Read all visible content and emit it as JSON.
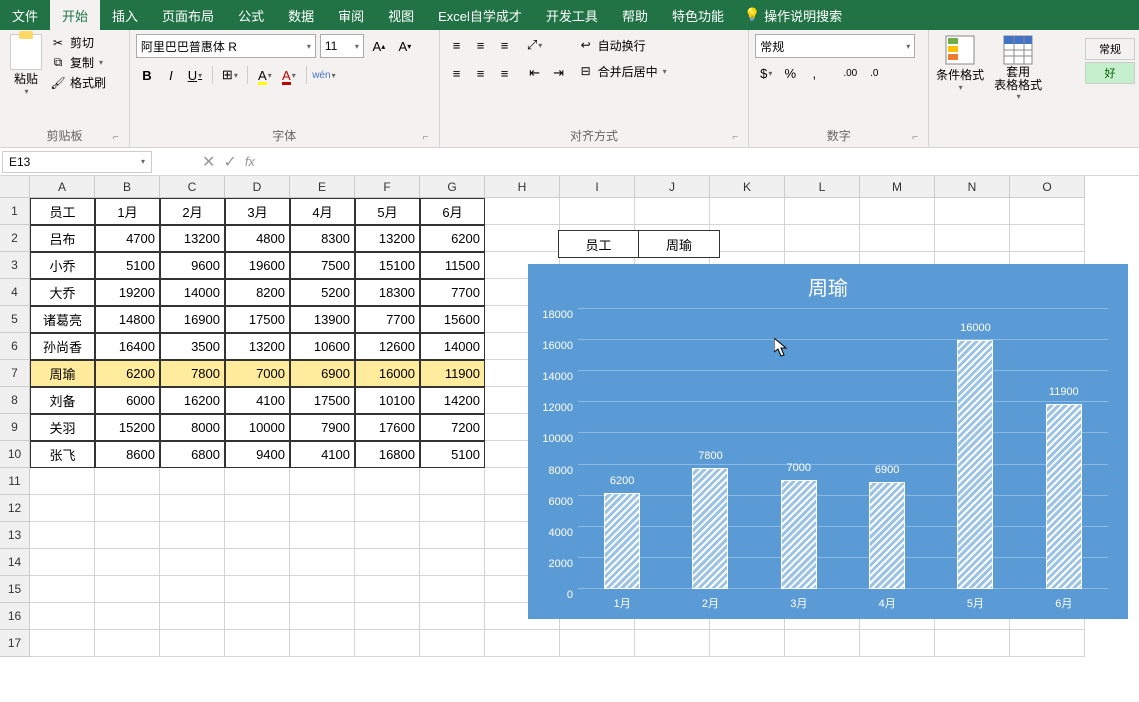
{
  "ribbon": {
    "tabs": [
      "文件",
      "开始",
      "插入",
      "页面布局",
      "公式",
      "数据",
      "审阅",
      "视图",
      "Excel自学成才",
      "开发工具",
      "帮助",
      "特色功能"
    ],
    "active_tab_index": 1,
    "tell_me": "操作说明搜索",
    "clipboard": {
      "paste": "粘贴",
      "cut": "剪切",
      "copy": "复制",
      "format_painter": "格式刷",
      "label": "剪贴板"
    },
    "font": {
      "family": "阿里巴巴普惠体 R",
      "size": "11",
      "label": "字体",
      "wen": "wén"
    },
    "align": {
      "wrap": "自动换行",
      "merge": "合并后居中",
      "label": "对齐方式"
    },
    "number": {
      "format": "常规",
      "label": "数字"
    },
    "styles": {
      "cond": "条件格式",
      "table": "套用\n表格格式",
      "normal": "常规",
      "good": "好"
    }
  },
  "namebox": "E13",
  "columns": [
    "A",
    "B",
    "C",
    "D",
    "E",
    "F",
    "G",
    "H",
    "I",
    "J",
    "K",
    "L",
    "M",
    "N",
    "O"
  ],
  "col_label_extra": "",
  "table": {
    "header": [
      "员工",
      "1月",
      "2月",
      "3月",
      "4月",
      "5月",
      "6月"
    ],
    "rows": [
      [
        "吕布",
        "4700",
        "13200",
        "4800",
        "8300",
        "13200",
        "6200"
      ],
      [
        "小乔",
        "5100",
        "9600",
        "19600",
        "7500",
        "15100",
        "11500"
      ],
      [
        "大乔",
        "19200",
        "14000",
        "8200",
        "5200",
        "18300",
        "7700"
      ],
      [
        "诸葛亮",
        "14800",
        "16900",
        "17500",
        "13900",
        "7700",
        "15600"
      ],
      [
        "孙尚香",
        "16400",
        "3500",
        "13200",
        "10600",
        "12600",
        "14000"
      ],
      [
        "周瑜",
        "6200",
        "7800",
        "7000",
        "6900",
        "16000",
        "11900"
      ],
      [
        "刘备",
        "6000",
        "16200",
        "4100",
        "17500",
        "10100",
        "14200"
      ],
      [
        "关羽",
        "15200",
        "8000",
        "10000",
        "7900",
        "17600",
        "7200"
      ],
      [
        "张飞",
        "8600",
        "6800",
        "9400",
        "4100",
        "16800",
        "5100"
      ]
    ],
    "highlight_row_index": 5
  },
  "lookup": {
    "label": "员工",
    "value": "周瑜"
  },
  "chart_data": {
    "type": "bar",
    "title": "周瑜",
    "categories": [
      "1月",
      "2月",
      "3月",
      "4月",
      "5月",
      "6月"
    ],
    "values": [
      6200,
      7800,
      7000,
      6900,
      16000,
      11900
    ],
    "ylim": [
      0,
      18000
    ],
    "yticks": [
      0,
      2000,
      4000,
      6000,
      8000,
      10000,
      12000,
      14000,
      16000,
      18000
    ],
    "xlabel": "",
    "ylabel": ""
  }
}
